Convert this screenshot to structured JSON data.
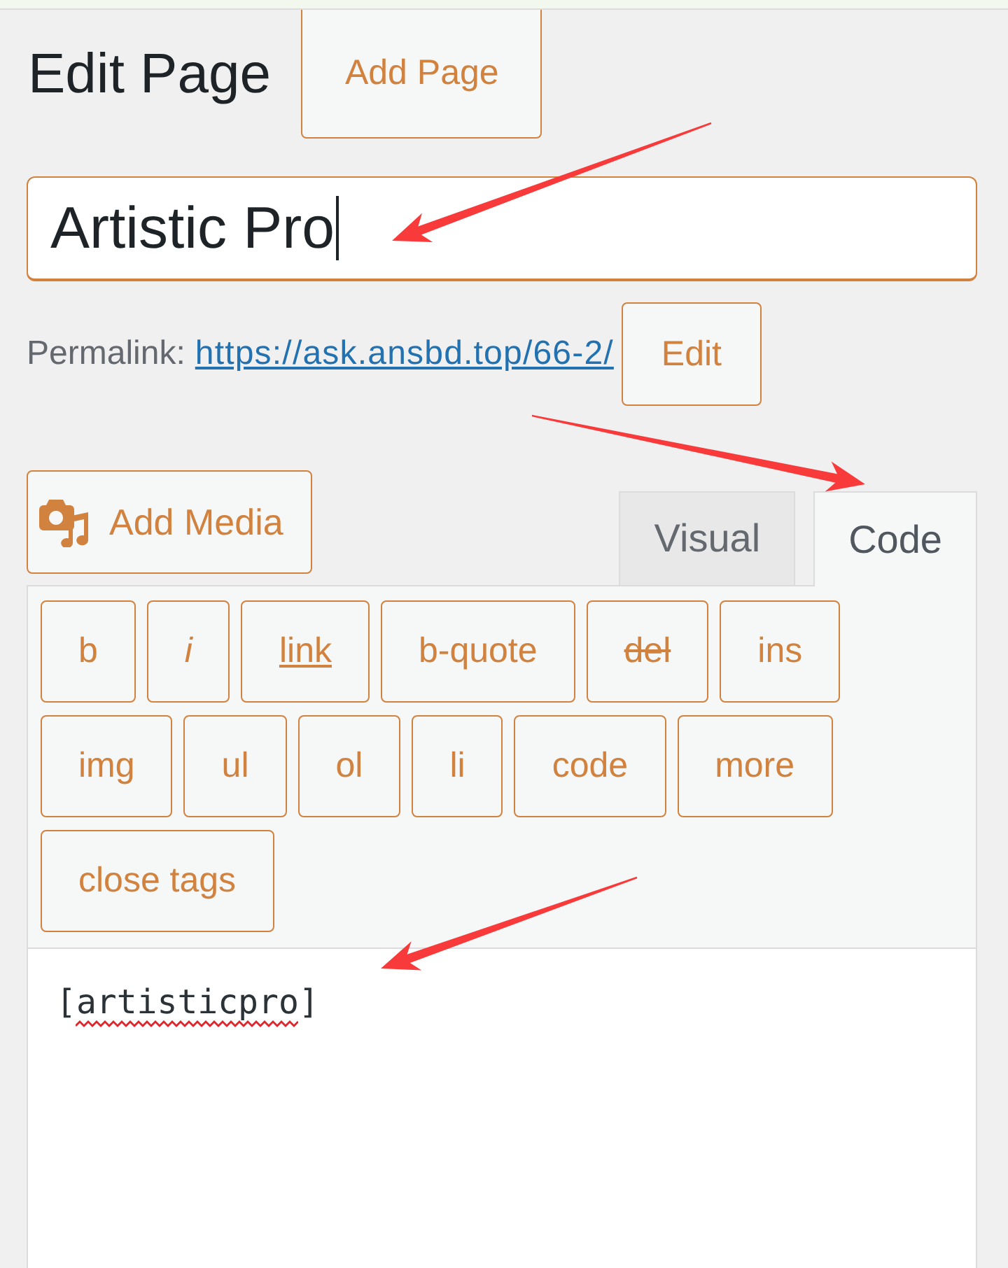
{
  "header": {
    "title": "Edit Page",
    "add_button": "Add Page"
  },
  "title_field": {
    "value": "Artistic Pro",
    "focused": true
  },
  "permalink": {
    "label": "Permalink:",
    "url": "https://ask.ansbd.top/66-2/",
    "edit_button": "Edit"
  },
  "media_button": {
    "label": "Add Media"
  },
  "editor_tabs": [
    {
      "label": "Visual",
      "selected": false
    },
    {
      "label": "Code",
      "selected": true
    }
  ],
  "quicktags": [
    {
      "label": "b",
      "kind": "plain"
    },
    {
      "label": "i",
      "kind": "italic"
    },
    {
      "label": "link",
      "kind": "underline"
    },
    {
      "label": "b-quote",
      "kind": "plain"
    },
    {
      "label": "del",
      "kind": "strike"
    },
    {
      "label": "ins",
      "kind": "plain"
    },
    {
      "label": "img",
      "kind": "plain"
    },
    {
      "label": "ul",
      "kind": "plain"
    },
    {
      "label": "ol",
      "kind": "plain"
    },
    {
      "label": "li",
      "kind": "plain"
    },
    {
      "label": "code",
      "kind": "plain"
    },
    {
      "label": "more",
      "kind": "plain"
    },
    {
      "label": "close tags",
      "kind": "plain"
    }
  ],
  "editor": {
    "content": "[artisticpro]",
    "spelling_flagged": true
  },
  "annotation_arrows": [
    {
      "kind": "arrow"
    },
    {
      "kind": "arrow"
    },
    {
      "kind": "arrow"
    }
  ]
}
